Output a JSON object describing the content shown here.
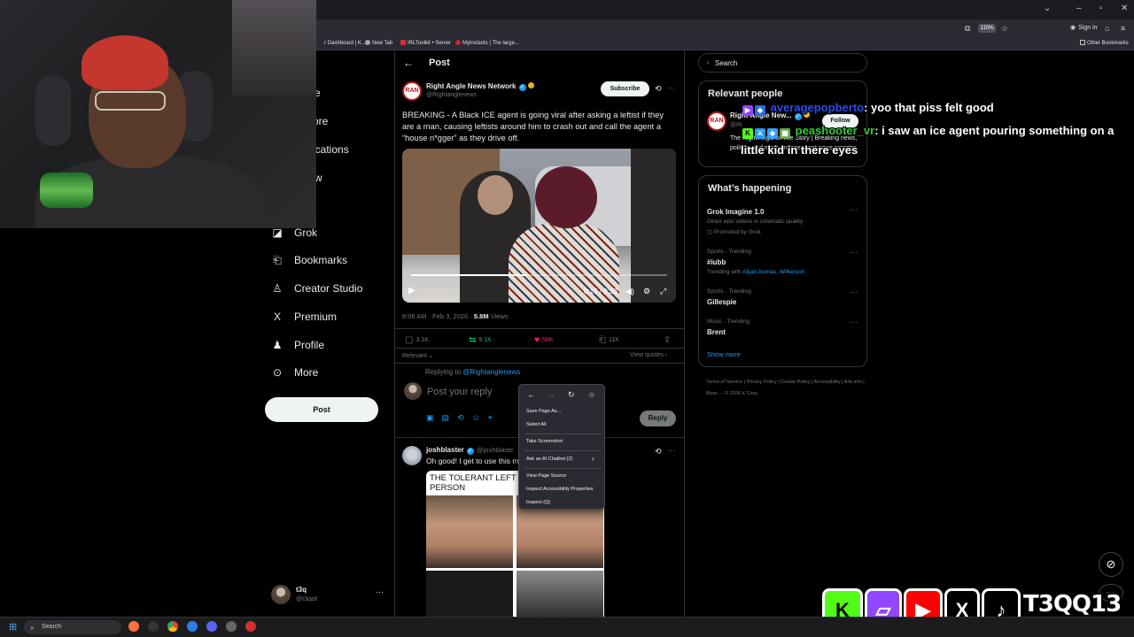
{
  "browser": {
    "zoom": "110%",
    "signin": "Sign in",
    "bookmarks": [
      {
        "label": "r Dashboard | K...",
        "color": "#3b82f6"
      },
      {
        "label": "New Tab",
        "color": "#9ca3af"
      },
      {
        "label": "IRLToolkit • Server",
        "color": "#d32f2f"
      },
      {
        "label": "Myinstants | The large...",
        "color": "#c62828"
      }
    ],
    "other_bookmarks": "Other Bookmarks"
  },
  "nav": {
    "partial": [
      "e",
      "ore",
      "ications",
      "w"
    ],
    "items": [
      {
        "label": "Grok",
        "icon": "grok-icon",
        "glyph": "◪"
      },
      {
        "label": "Bookmarks",
        "icon": "bookmark-icon",
        "glyph": "🔖"
      },
      {
        "label": "Creator Studio",
        "icon": "creator-studio-icon",
        "glyph": "⚡"
      },
      {
        "label": "Premium",
        "icon": "x-logo-icon",
        "glyph": "𝕏"
      },
      {
        "label": "Profile",
        "icon": "profile-icon",
        "glyph": "👤"
      },
      {
        "label": "More",
        "icon": "more-circle-icon",
        "glyph": "⋯"
      }
    ],
    "post_button": "Post",
    "account": {
      "name": "t3q",
      "handle": "@t3qalt"
    }
  },
  "post": {
    "heading": "Post",
    "author": {
      "name": "Right Angle News Network",
      "handle": "@Rightanglenews",
      "avatar_text": "RAN"
    },
    "subscribe": "Subscribe",
    "text": "BREAKING - A Black ICE agent is going viral after asking a leftist if they are a man, causing leftists around him to crash out and call the agent a “house n*gger” as they drive off.",
    "video": {
      "time": "0:15 / 0:33",
      "progress": 0.45
    },
    "timestamp": "8:06 AM · Feb 3, 2026 · ",
    "views": "5.8M",
    "views_label": " Views",
    "actions": {
      "replies": "3.1K",
      "reposts": "9.1K",
      "likes": "58K",
      "bookmarks": "11K"
    },
    "sort": "Relevant",
    "view_quotes": "View quotes",
    "replying_prefix": "Replying to ",
    "replying_to": "@Rightanglenews",
    "reply_placeholder": "Post your reply",
    "reply_button": "Reply"
  },
  "reply_tweet": {
    "name": "joshblaster",
    "handle": "@joshblaste",
    "text": "Oh good! I get to use this me",
    "meme_caption": "THE TOLERANT LEFT W OUT A BLACK PERSON"
  },
  "context_menu": {
    "items": [
      "Save Page As...",
      "Select All",
      "Take Screenshot",
      "Ask an AI Chatbot (Z)",
      "View Page Source",
      "Inspect Accessibility Properties",
      "Inspect (Q)"
    ]
  },
  "right": {
    "search_placeholder": "Search",
    "relevant_people": {
      "title": "Relevant people",
      "name": "Right Angle New...",
      "handle": "@Ri",
      "follow": "Follow",
      "bio": "The Right Angle of The Story | Breaking news, politics, and more. Independent news reporter"
    },
    "whats_happening": {
      "title": "What’s happening",
      "trends": [
        {
          "meta": "",
          "title": "Grok Imagine 1.0",
          "sub": "Direct epic videos in cinematic quality.",
          "sub2": "Promoted by Grok"
        },
        {
          "meta": "Sports · Trending",
          "title": "#iubb",
          "sub": "Trending with ",
          "links": "Alijah Arenas, Wilkerson"
        },
        {
          "meta": "Sports · Trending",
          "title": "Gillespie"
        },
        {
          "meta": "Music · Trending",
          "title": "Brent"
        }
      ],
      "show_more": "Show more"
    },
    "footer": "Terms of Service  |  Privacy Policy  |  Cookie Policy  |  Accessibility  |  Ads info  |  More ···  © 2026 X Corp."
  },
  "chat": [
    {
      "user": "averagepopberto",
      "message": ": yoo that piss felt good"
    },
    {
      "user": "peashooter_vr",
      "message": ": i saw an ice agent pouring something on a",
      "message2": "little kid in there eyes"
    }
  ],
  "socials": {
    "handle": "T3QQ13"
  },
  "taskbar": {
    "search": "Search"
  }
}
